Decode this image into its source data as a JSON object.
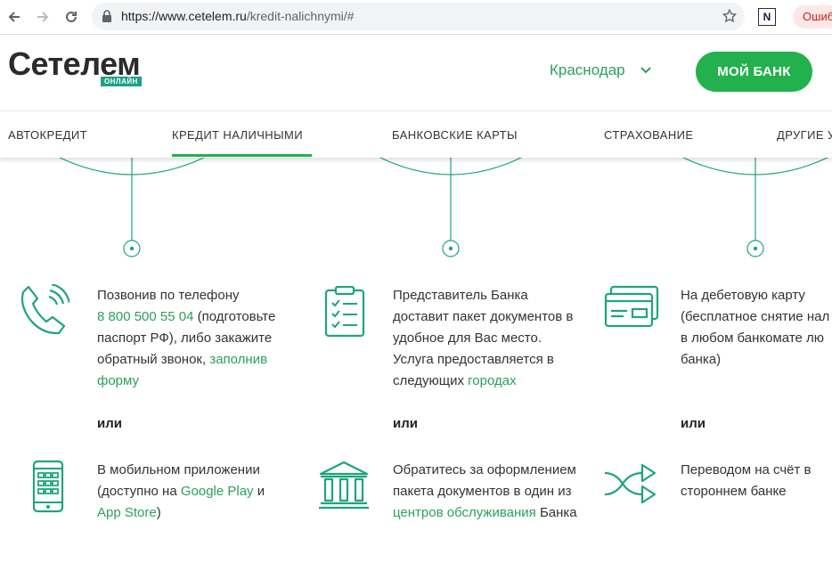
{
  "browser": {
    "url_host": "https://www.cetelem.ru",
    "url_path": "/kredit-nalichnymi/#",
    "extension_label": "N",
    "error_label": "Ошиб"
  },
  "header": {
    "logo_text": "Сетелем",
    "logo_badge": "ОНЛАЙН",
    "city": "Краснодар",
    "my_bank_button": "МОЙ БАНК"
  },
  "menu": {
    "items": [
      {
        "label": "АВТОКРЕДИТ"
      },
      {
        "label": "КРЕДИТ НАЛИЧНЫМИ"
      },
      {
        "label": "БАНКОВСКИЕ КАРТЫ"
      },
      {
        "label": "СТРАХОВАНИЕ"
      },
      {
        "label": "ДРУГИЕ У"
      }
    ]
  },
  "columns": [
    {
      "block1": {
        "l1": "Позвонив по телефону",
        "phone": "8 800 500 55 04",
        "l2_rest": " (подготовьте",
        "l3": "паспорт РФ), либо закажите",
        "l4_text": "обратный звонок, ",
        "l4_link": "заполнив",
        "l5_link": "форму"
      },
      "or": "или",
      "block2": {
        "l1": "В мобильном приложении",
        "l2_text": "(доступно на ",
        "l2_link": "Google Play",
        "l2_rest": " и",
        "l3_link": "App Store",
        "l3_rest": ")"
      }
    },
    {
      "block1": {
        "l1": "Представитель Банка",
        "l2": "доставит пакет документов в",
        "l3": "удобное для Вас место.",
        "l4": "Услуга предоставляется в",
        "l5_text": "следующих ",
        "l5_link": "городах"
      },
      "or": "или",
      "block2": {
        "l1": "Обратитесь за оформлением",
        "l2": "пакета документов в один из",
        "l3_link": "центров обслуживания",
        "l3_rest": " Банка"
      }
    },
    {
      "block1": {
        "l1": "На дебетовую карту",
        "l2": "(бесплатное снятие нал",
        "l3": "в любом банкомате лю",
        "l4": "банка)"
      },
      "or": "или",
      "block2": {
        "l1": "Переводом на счёт в",
        "l2": "стороннем банке"
      }
    }
  ],
  "icons": {
    "phone": "phone-call-icon",
    "clipboard": "checklist-clipboard-icon",
    "card": "bank-card-icon",
    "mobile": "mobile-app-icon",
    "bank": "bank-building-icon",
    "transfer": "transfer-arrows-icon"
  },
  "colors": {
    "accent": "#22b14c",
    "link": "#2ca05a",
    "icon_teal": "#1ea57a",
    "badge": "#1e9f86"
  }
}
